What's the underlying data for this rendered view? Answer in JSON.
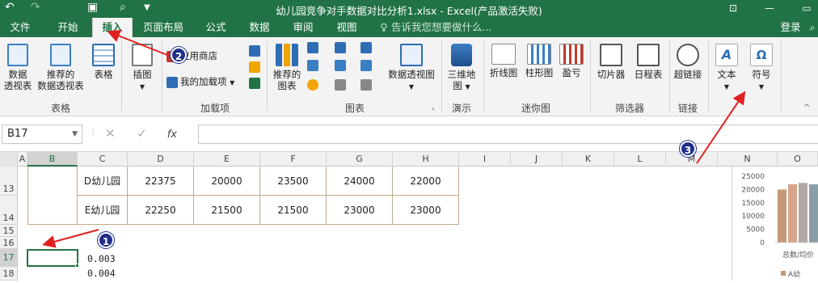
{
  "title_bar": {
    "title": "幼儿园竞争对手数据对比分析1.xlsx - Excel(产品激活失败)",
    "icons": [
      "undo-icon",
      "redo-icon",
      "save-icon",
      "print-preview-icon",
      "more-icon"
    ],
    "window_buttons": [
      "ribbon-display-icon",
      "minimize-icon",
      "restore-icon"
    ]
  },
  "tabs": [
    {
      "label": "文件"
    },
    {
      "label": "开始"
    },
    {
      "label": "插入",
      "active": true
    },
    {
      "label": "页面布局"
    },
    {
      "label": "公式"
    },
    {
      "label": "数据"
    },
    {
      "label": "审阅"
    },
    {
      "label": "视图"
    }
  ],
  "tell_me": "告诉我您想要做什么...",
  "login": "登录",
  "ribbon": {
    "groups": [
      {
        "name": "表格",
        "buttons": [
          "数据\n透视表",
          "推荐的\n数据透视表",
          "表格"
        ]
      },
      {
        "name": "插图",
        "buttons": [
          "插图"
        ]
      },
      {
        "name": "加载项",
        "buttons": [
          "应用商店",
          "我的加载项"
        ]
      },
      {
        "name": "图表",
        "buttons": [
          "推荐的\n图表",
          "数据透视图"
        ]
      },
      {
        "name": "演示",
        "buttons": [
          "三维地\n图"
        ]
      },
      {
        "name": "迷你图",
        "buttons": [
          "折线图",
          "柱形图",
          "盈亏"
        ]
      },
      {
        "name": "筛选器",
        "buttons": [
          "切片器",
          "日程表"
        ]
      },
      {
        "name": "链接",
        "buttons": [
          "超链接"
        ]
      },
      {
        "name": "",
        "buttons": [
          "文本",
          "符号"
        ]
      }
    ]
  },
  "formula_bar": {
    "name_box": "B17",
    "fx": "fx",
    "value": ""
  },
  "columns": [
    "A",
    "B",
    "C",
    "D",
    "E",
    "F",
    "G",
    "H",
    "I",
    "J",
    "K",
    "L",
    "M",
    "N",
    "O"
  ],
  "selected_column": "B",
  "rows": [
    "13",
    "14",
    "15",
    "16",
    "17",
    "18"
  ],
  "selected_row": "17",
  "table_rows": [
    {
      "label": "D幼儿园",
      "values": [
        "22375",
        "20000",
        "23500",
        "24000",
        "22000"
      ]
    },
    {
      "label": "E幼儿园",
      "values": [
        "22250",
        "21500",
        "21500",
        "23000",
        "23000"
      ]
    }
  ],
  "loose_values": [
    "0.003",
    "0.004"
  ],
  "annotations": [
    "1",
    "2",
    "3"
  ],
  "chart_data": {
    "type": "bar",
    "yticks": [
      "25000",
      "20000",
      "15000",
      "10000",
      "5000",
      "0"
    ],
    "ylim": [
      0,
      25000
    ],
    "xlabel_partial": "总数/均价",
    "legend_partial": "A幼",
    "values": [
      20000,
      22000,
      22500,
      22000
    ],
    "colors": [
      "#c49a7a",
      "#d8a48a",
      "#b0a8a4",
      "#8a9ea8"
    ]
  },
  "colors": {
    "accent": "#217346",
    "arrow": "#e02020",
    "annotation": "#1f2f8a",
    "table_border": "#c4a88a"
  }
}
